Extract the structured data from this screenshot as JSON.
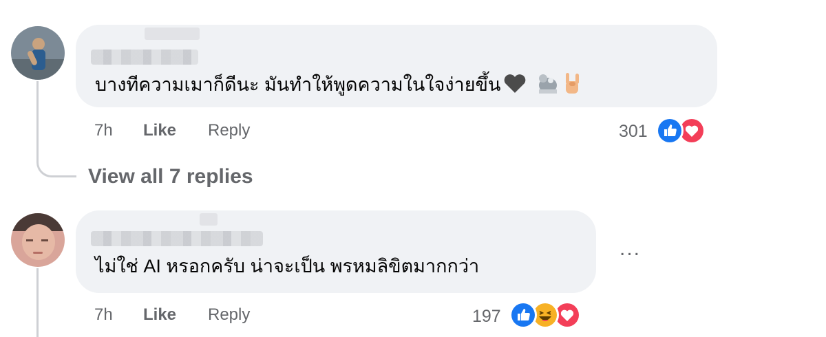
{
  "comments": [
    {
      "text": "บางทีความเมาก็ดีนะ มันทำให้พูดความในใจง่ายขึ้น",
      "inline_emojis": [
        "black-heart",
        "monkey-sticker",
        "rock-on-hand"
      ],
      "time": "7h",
      "like_label": "Like",
      "reply_label": "Reply",
      "reaction_count": "301",
      "reactions": [
        "like",
        "love"
      ],
      "view_replies_label": "View all 7 replies"
    },
    {
      "text": "ไม่ใช่ AI หรอกครับ น่าจะเป็น พรหมลิขิตมากกว่า",
      "time": "7h",
      "like_label": "Like",
      "reply_label": "Reply",
      "reaction_count": "197",
      "reactions": [
        "like",
        "haha",
        "love"
      ],
      "more_label": "..."
    }
  ],
  "colors": {
    "bubble": "#f0f2f5",
    "meta_text": "#65676b",
    "like_blue": "#1877f2",
    "love_red": "#f33e58",
    "haha_yellow": "#f7b125"
  }
}
